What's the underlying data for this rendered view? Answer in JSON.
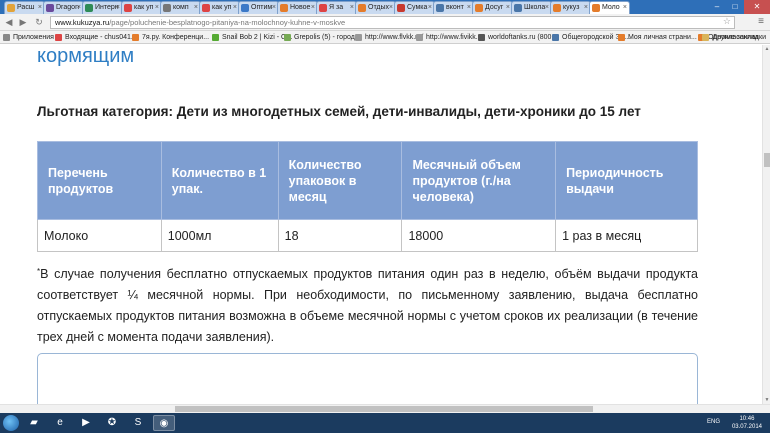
{
  "browser": {
    "tabs": [
      {
        "label": "Расш",
        "color": "#e2a33a"
      },
      {
        "label": "Dragon",
        "color": "#6a4a9c"
      },
      {
        "label": "Интерн",
        "color": "#2e8b57"
      },
      {
        "label": "как уп",
        "color": "#d44"
      },
      {
        "label": "комп",
        "color": "#777"
      },
      {
        "label": "как уп",
        "color": "#d44"
      },
      {
        "label": "Оптим",
        "color": "#3c79c7"
      },
      {
        "label": "Новое",
        "color": "#e47c2b"
      },
      {
        "label": "Я за",
        "color": "#d44"
      },
      {
        "label": "Отдых",
        "color": "#e47c2b"
      },
      {
        "label": "Сумка",
        "color": "#c7392f"
      },
      {
        "label": "вконт",
        "color": "#4a76a8"
      },
      {
        "label": "Досуг",
        "color": "#e47c2b"
      },
      {
        "label": "Школа",
        "color": "#4a76a8"
      },
      {
        "label": "кукуз",
        "color": "#e47c2b"
      },
      {
        "label": "Моло",
        "color": "#e47c2b"
      }
    ],
    "url_domain": "www.kukuzya.ru",
    "url_path": "/page/poluchenie-besplatnogo-pitaniya-na-molochnoy-kuhne-v-moskve",
    "back_icon": "back-arrow-icon",
    "forward_icon": "forward-arrow-icon",
    "reload_icon": "reload-icon",
    "home_icon": "home-icon",
    "menu_icon": "hamburger-menu-icon"
  },
  "bookmarks": [
    {
      "label": "Приложения",
      "color": "#888"
    },
    {
      "label": "Входящие - chus041...",
      "color": "#d44"
    },
    {
      "label": "7я.ру. Конференци...",
      "color": "#e47c2b"
    },
    {
      "label": "Snail Bob 2 | Kizi - О...",
      "color": "#5a3"
    },
    {
      "label": "Grepolis (5) - город ...",
      "color": "#7a5"
    },
    {
      "label": "http://www.flvkk.ru/",
      "color": "#999"
    },
    {
      "label": "http://www.fivikk.ru",
      "color": "#999"
    },
    {
      "label": "worldoftanks.ru (800...",
      "color": "#555"
    },
    {
      "label": "Общегородской Эл...",
      "color": "#4a76a8"
    },
    {
      "label": "Моя личная страни...",
      "color": "#e47c2b"
    },
    {
      "label": "Одноклассники",
      "color": "#e47c2b"
    }
  ],
  "bookmarks_other": "Другие закладки",
  "page": {
    "heading_fragment": "кормящим",
    "category_title": "Льготная категория: Дети из многодетных семей, дети-инвалиды, дети-хроники до 15 лет",
    "table": {
      "headers": [
        "Перечень продуктов",
        "Количество в 1 упак.",
        "Количество упаковок в месяц",
        "Месячный объем продуктов (г./на человека)",
        "Периодичность выдачи"
      ],
      "rows": [
        [
          "Молоко",
          "1000мл",
          "18",
          "18000",
          "1 раз в месяц"
        ]
      ]
    },
    "footnote_marker": "*",
    "footnote": "В случае получения бесплатно отпускаемых продуктов питания один раз в неделю, объём выдачи продукта соответствует ¼ месячной нормы. При необходимости, по письменному заявлению, выдача бесплатно отпускаемых продуктов питания возможна в объеме месячной нормы с учетом сроков их реализации (в течение трех дней с момента подачи заявления)."
  },
  "taskbar": {
    "apps": [
      {
        "name": "explorer",
        "icon": "folder-icon",
        "glyph": "▰"
      },
      {
        "name": "ie",
        "icon": "internet-explorer-icon",
        "glyph": "e"
      },
      {
        "name": "media",
        "icon": "media-player-icon",
        "glyph": "▶"
      },
      {
        "name": "game",
        "icon": "tanks-game-icon",
        "glyph": "✪"
      },
      {
        "name": "skype",
        "icon": "skype-icon",
        "glyph": "S"
      },
      {
        "name": "chrome",
        "icon": "chrome-icon",
        "glyph": "◉"
      }
    ],
    "lang": "ENG",
    "time": "10:46",
    "date": "03.07.2014"
  }
}
